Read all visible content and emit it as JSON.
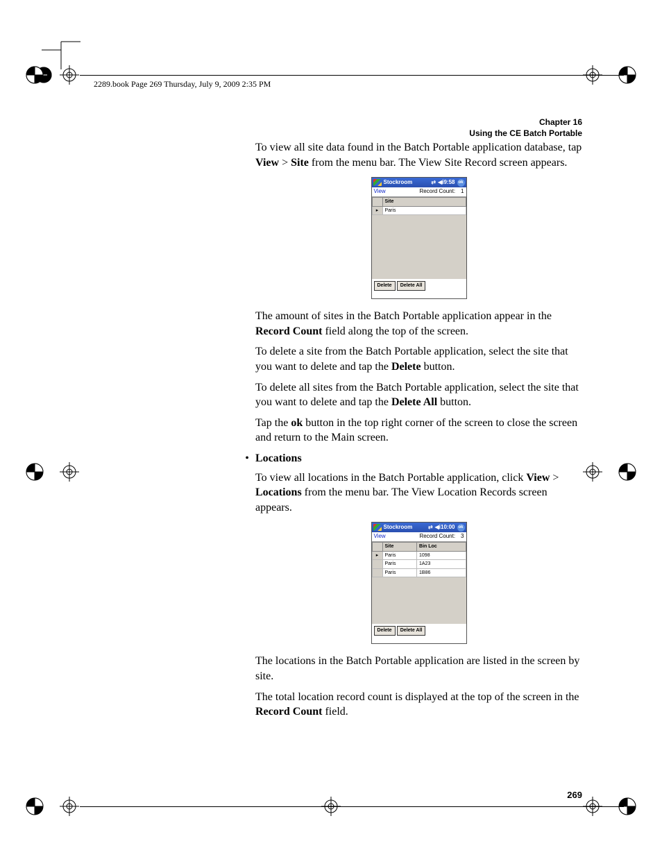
{
  "header_line": "2289.book  Page 269  Thursday, July 9, 2009  2:35 PM",
  "chapter": {
    "line1": "Chapter 16",
    "line2": "Using the CE Batch Portable"
  },
  "para1a": "To view all site data found in the Batch Portable application database, tap ",
  "para1_view": "View",
  "para1_sep": " > ",
  "para1_site": "Site",
  "para1b": " from the menu bar. The View Site Record screen appears.",
  "fig1": {
    "title": "Stockroom",
    "time": "9:58",
    "menu_view": "View",
    "record_count_label": "Record Count:",
    "record_count_value": "1",
    "col_site": "Site",
    "rows": [
      {
        "site": "Paris"
      }
    ],
    "btn_delete": "Delete",
    "btn_delete_all": "Delete All"
  },
  "para2a": "The amount of sites in the Batch Portable application appear in the ",
  "para2_bold": "Record Count",
  "para2b": " field along the top of the screen.",
  "para3a": "To delete a site from the Batch Portable application, select the site that you want to delete and tap the ",
  "para3_bold": "Delete",
  "para3b": " button.",
  "para4a": "To delete all sites from the Batch Portable application, select the site that you want to delete and tap the ",
  "para4_bold": "Delete All",
  "para4b": " button.",
  "para5a": "Tap the ",
  "para5_bold": "ok",
  "para5b": " button in the top right corner of the screen to close the screen and return to the Main screen.",
  "bullet_dot": "•",
  "bullet_label": "Locations",
  "para6a": "To view all locations in the Batch Portable application, click ",
  "para6_view": "View",
  "para6_sep": " > ",
  "para6_loc": "Locations",
  "para6b": " from the menu bar. The View Location Records screen appears.",
  "fig2": {
    "title": "Stockroom",
    "time": "10:00",
    "menu_view": "View",
    "record_count_label": "Record Count:",
    "record_count_value": "3",
    "col_site": "Site",
    "col_binloc": "Bin Loc",
    "rows": [
      {
        "site": "Paris",
        "bin": "1098"
      },
      {
        "site": "Paris",
        "bin": "1A23"
      },
      {
        "site": "Paris",
        "bin": "1B86"
      }
    ],
    "btn_delete": "Delete",
    "btn_delete_all": "Delete All"
  },
  "para7": "The locations in the Batch Portable application are listed in the screen by site.",
  "para8a": "The total location record count is displayed at the top of the screen in the ",
  "para8_bold": "Record Count",
  "para8b": " field.",
  "page_number": "269",
  "ok_text": "ok"
}
